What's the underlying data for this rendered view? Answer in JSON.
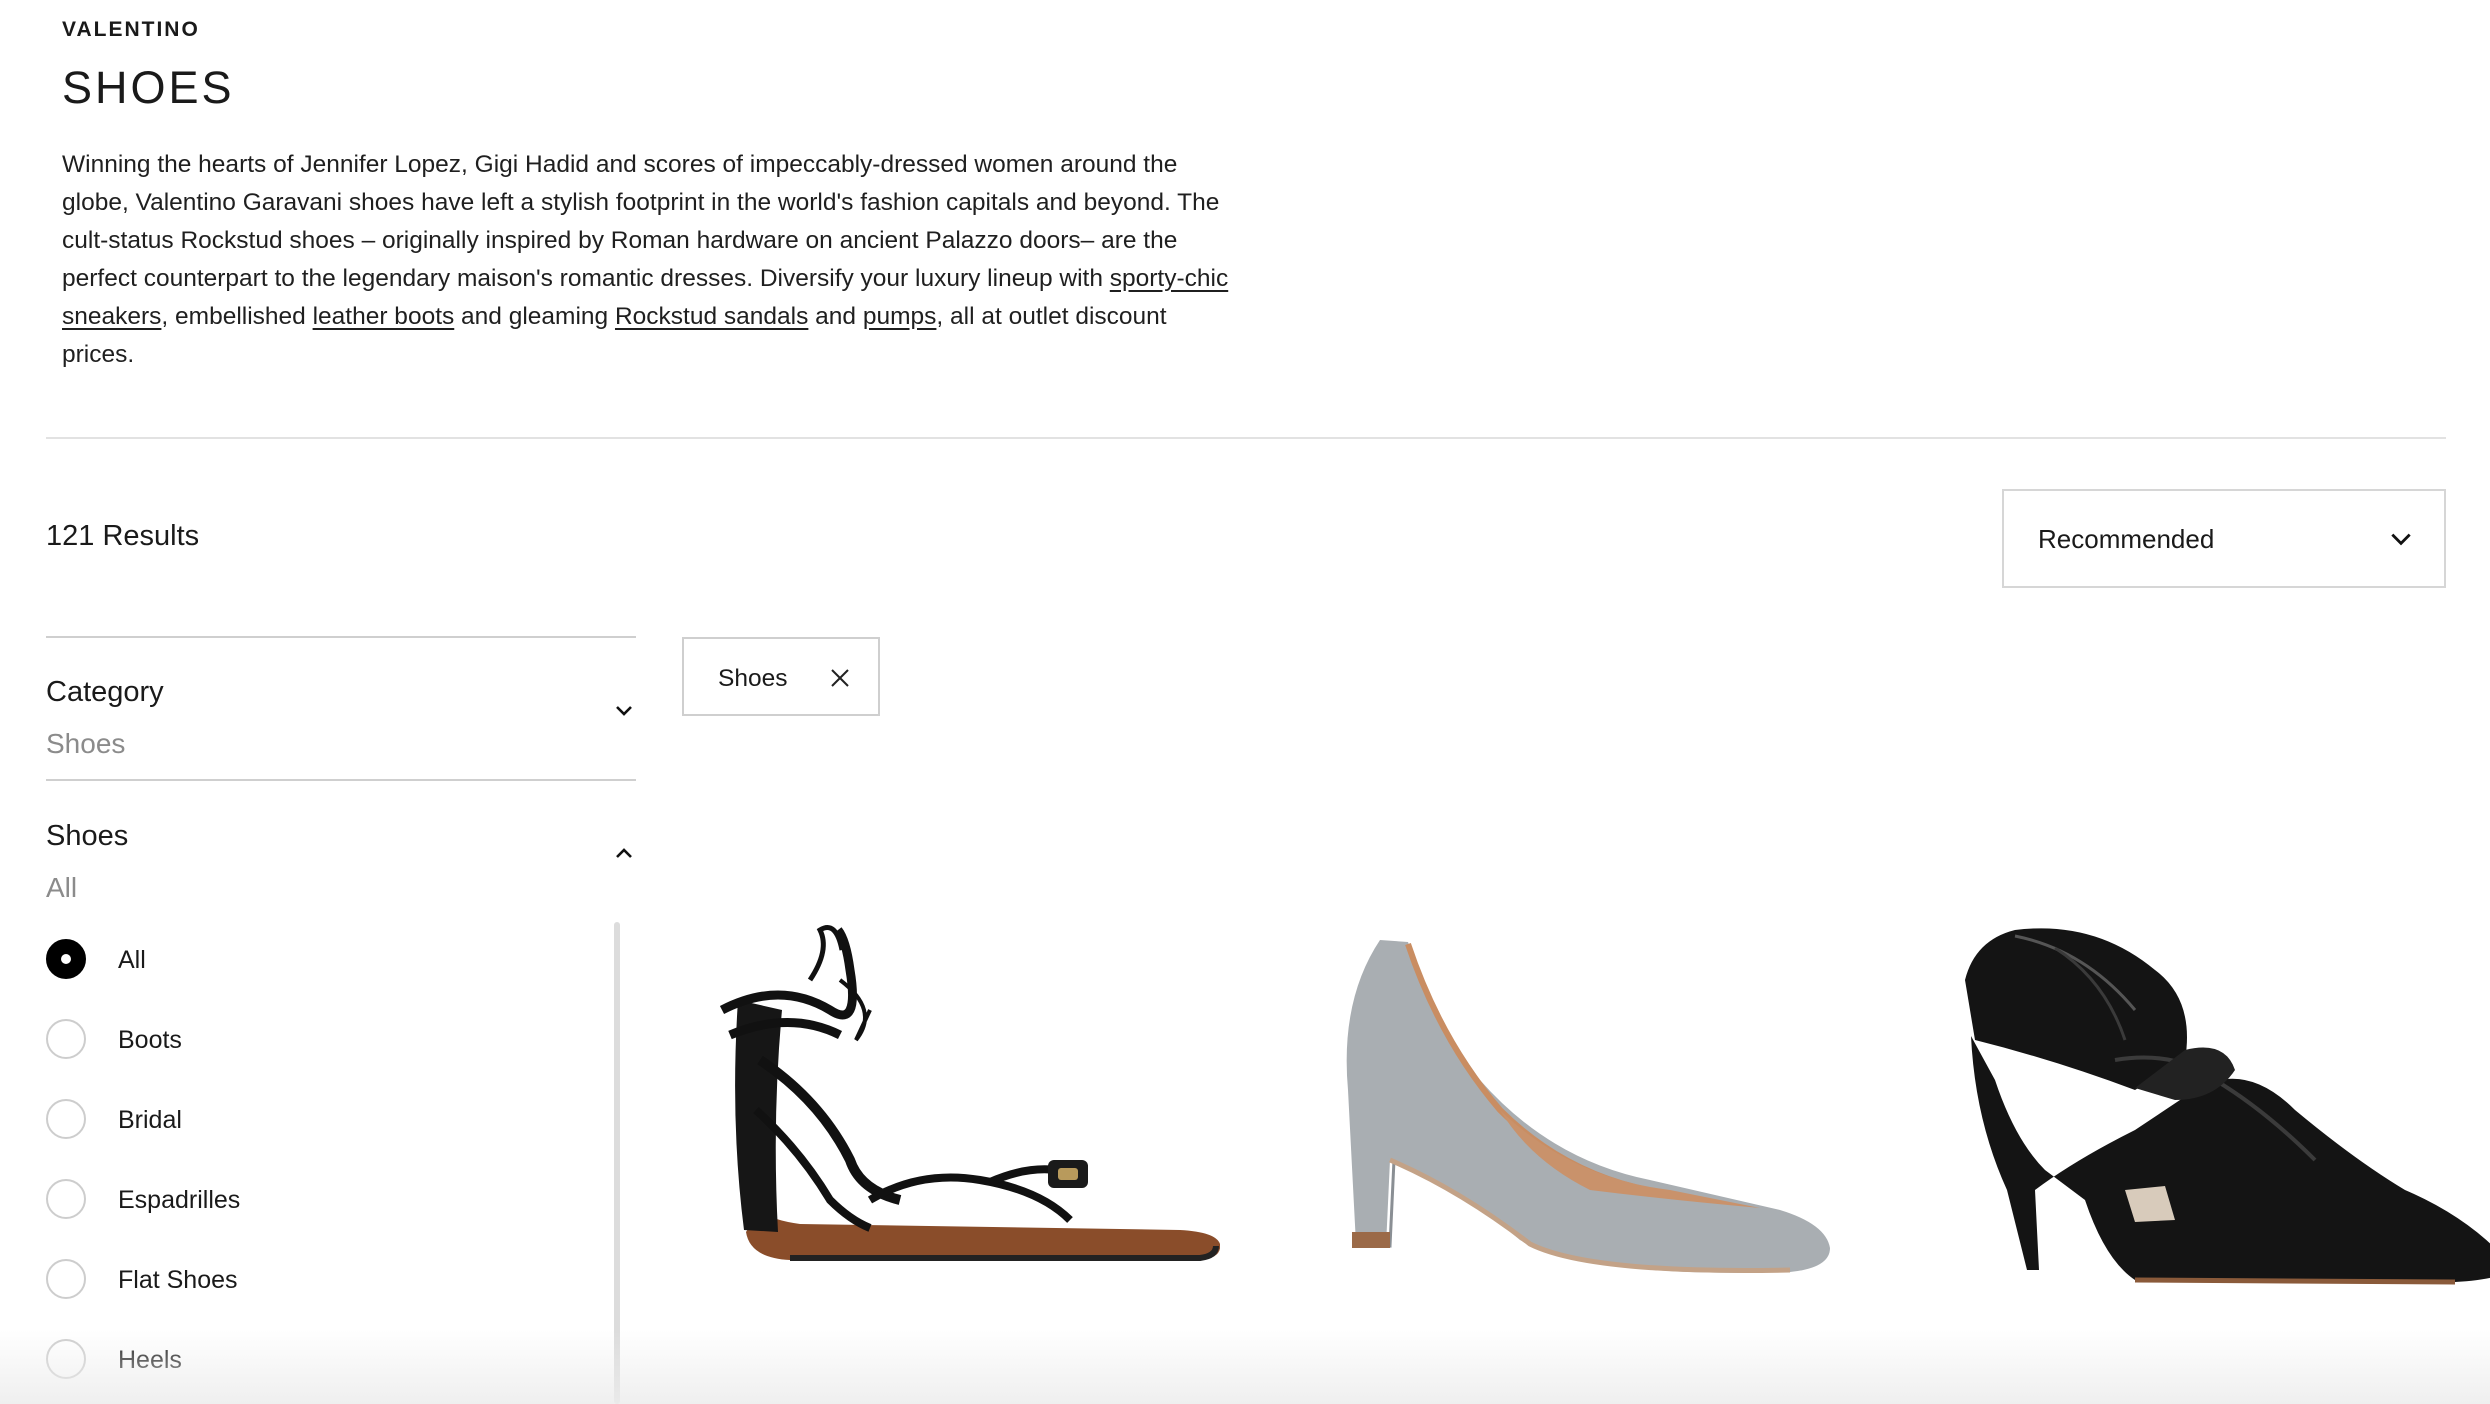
{
  "header": {
    "brand": "VALENTINO",
    "title": "SHOES"
  },
  "intro": {
    "text_1": "Winning the hearts of Jennifer Lopez, Gigi Hadid and scores of impeccably-dressed women around the globe, Valentino Garavani shoes have left a stylish footprint in the world's fashion capitals and beyond. The cult-status Rockstud shoes – originally inspired by Roman hardware on ancient Palazzo doors– are the perfect counterpart to the legendary maison's romantic dresses. Diversify your luxury lineup with ",
    "link_sneakers": "sporty-chic sneakers",
    "text_2": ", embellished ",
    "link_boots": "leather boots",
    "text_3": " and gleaming ",
    "link_sandals": "Rockstud sandals",
    "text_4": " and ",
    "link_pumps": "pumps",
    "text_5": ", all at outlet discount prices."
  },
  "listing": {
    "results": "121 Results",
    "sort_value": "Recommended"
  },
  "filters": {
    "category": {
      "label": "Category",
      "value": "Shoes"
    },
    "shoes": {
      "label": "Shoes",
      "value": "All",
      "options": [
        {
          "label": "All",
          "selected": true
        },
        {
          "label": "Boots",
          "selected": false
        },
        {
          "label": "Bridal",
          "selected": false
        },
        {
          "label": "Espadrilles",
          "selected": false
        },
        {
          "label": "Flat Shoes",
          "selected": false
        },
        {
          "label": "Heels",
          "selected": false
        }
      ]
    }
  },
  "active_filters": [
    {
      "label": "Shoes"
    }
  ],
  "products": [
    {
      "image": "black-lace-up-flat-sandal"
    },
    {
      "image": "grey-suede-pump"
    },
    {
      "image": "black-leather-ruffle-pump"
    }
  ],
  "colors": {
    "text": "#1a1a1a",
    "muted": "#8b8b8b",
    "border": "#cfcfcf"
  }
}
